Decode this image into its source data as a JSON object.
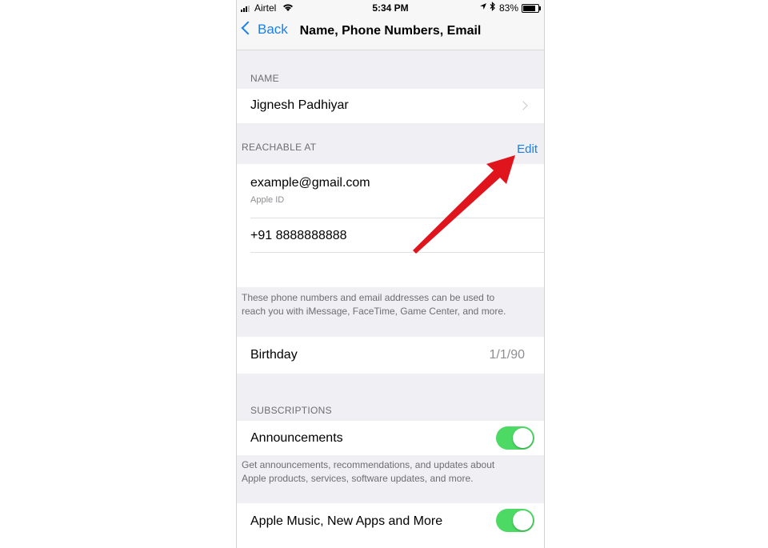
{
  "status_bar": {
    "carrier": "Airtel",
    "time": "5:34 PM",
    "battery": "83%",
    "battery_level": 0.83
  },
  "nav": {
    "back_label": "Back",
    "title": "Name, Phone Numbers, Email"
  },
  "name_section": {
    "header": "NAME",
    "name": "Jignesh Padhiyar"
  },
  "reachable_section": {
    "header": "REACHABLE AT",
    "edit_label": "Edit",
    "email": "example@gmail.com",
    "email_sub": "Apple ID",
    "phone": "+91 8888888888",
    "footer_line1": "These phone numbers and email addresses can be used to",
    "footer_line2": "reach you with iMessage, FaceTime, Game Center, and more."
  },
  "birthday": {
    "label": "Birthday",
    "value": "1/1/90"
  },
  "subscriptions": {
    "header": "SUBSCRIPTIONS",
    "announcements_label": "Announcements",
    "announcements_on": true,
    "footer_line1": "Get announcements, recommendations, and updates about",
    "footer_line2": "Apple products, services, software updates, and more.",
    "music_label": "Apple Music, New Apps and More",
    "music_on": true
  },
  "annotation": {
    "arrow_color": "#e0141c"
  },
  "colors": {
    "accent": "#1a7fe6",
    "toggle_on": "#4cd964",
    "group_bg": "#efeff4"
  }
}
